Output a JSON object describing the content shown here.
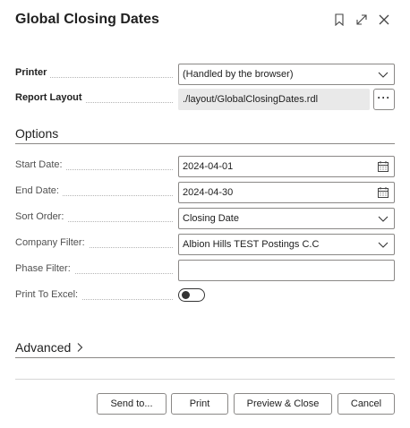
{
  "dialog": {
    "title": "Global Closing Dates",
    "icons": {
      "bookmark": "bookmark-icon",
      "expand": "expand-icon",
      "close": "close-icon"
    }
  },
  "printer": {
    "label": "Printer",
    "value": "(Handled by the browser)"
  },
  "report_layout": {
    "label": "Report Layout",
    "value": "./layout/GlobalClosingDates.rdl",
    "button_label": "···"
  },
  "options": {
    "title": "Options",
    "start_date": {
      "label": "Start Date:",
      "value": "2024-04-01"
    },
    "end_date": {
      "label": "End Date:",
      "value": "2024-04-30"
    },
    "sort_order": {
      "label": "Sort Order:",
      "value": "Closing Date"
    },
    "company_filter": {
      "label": "Company Filter:",
      "value": "Albion Hills TEST Postings C.C"
    },
    "phase_filter": {
      "label": "Phase Filter:",
      "value": ""
    },
    "print_to_excel": {
      "label": "Print To Excel:",
      "enabled": false
    }
  },
  "advanced": {
    "title": "Advanced"
  },
  "buttons": {
    "send_to": "Send to...",
    "print": "Print",
    "preview_close": "Preview & Close",
    "cancel": "Cancel"
  },
  "colors": {
    "text": "#212121",
    "label": "#505050",
    "border": "#8a8886",
    "readonly_bg": "#e9e9e9"
  }
}
